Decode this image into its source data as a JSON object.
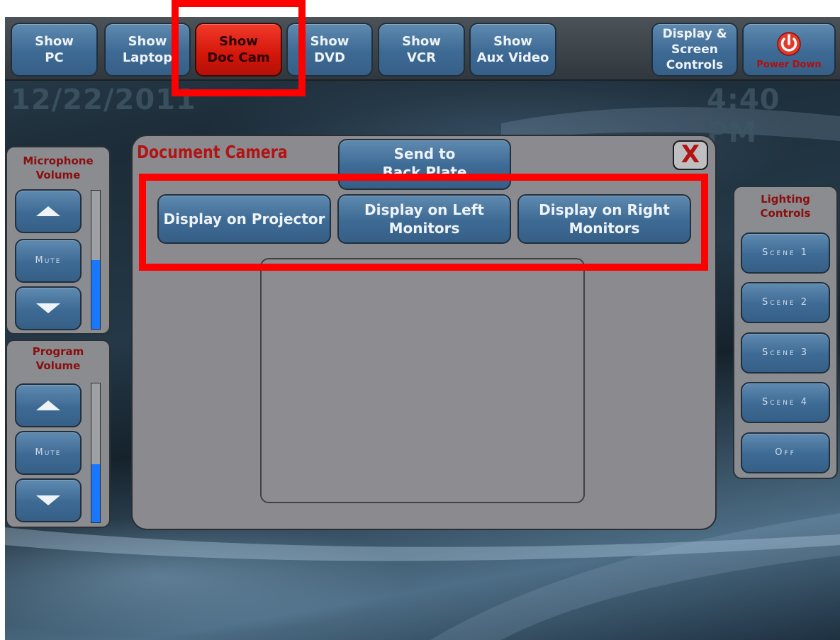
{
  "top_nav": [
    {
      "label": "Show\nPC"
    },
    {
      "label": "Show\nLaptop"
    },
    {
      "label": "Show\nDoc Cam",
      "active": true
    },
    {
      "label": "Show\nDVD"
    },
    {
      "label": "Show\nVCR"
    },
    {
      "label": "Show\nAux Video"
    },
    {
      "label": "Display &\nScreen\nControls"
    }
  ],
  "power": {
    "label": "Power Down",
    "icon": "power-icon"
  },
  "date": "12/22/2011",
  "time": "4:40 PM",
  "microphone": {
    "title": "Microphone\nVolume",
    "mute_label": "Mute",
    "level": 0.5
  },
  "program": {
    "title": "Program\nVolume",
    "mute_label": "Mute",
    "level": 0.42
  },
  "lighting": {
    "title": "Lighting\nControls",
    "scenes": [
      "Scene 1",
      "Scene 2",
      "Scene 3",
      "Scene 4",
      "Off"
    ]
  },
  "dialog": {
    "title": "Document Camera",
    "close_label": "X",
    "send_label": "Send to\nBack Plate",
    "buttons": [
      "Display on Projector",
      "Display on Left\nMonitors",
      "Display on Right\nMonitors"
    ]
  },
  "colors": {
    "highlight": "#ff0000",
    "active": "#d3160a",
    "accent_blue": "#3d6a94",
    "level_fill": "#1778ff"
  }
}
